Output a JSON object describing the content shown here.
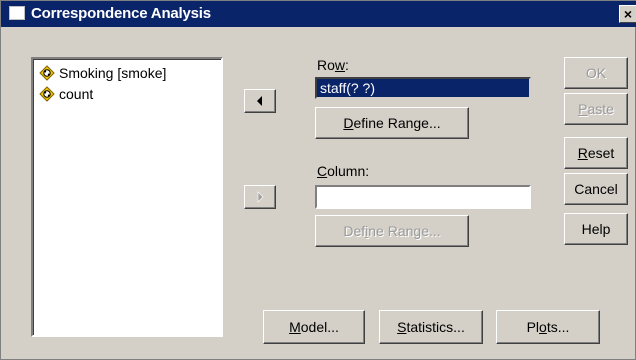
{
  "window": {
    "title": "Correspondence Analysis",
    "close_label": "×"
  },
  "variables": [
    {
      "label": "Smoking [smoke]",
      "icon": "nominal-variable-icon"
    },
    {
      "label": "count",
      "icon": "nominal-variable-icon"
    }
  ],
  "row": {
    "label_prefix": "Ro",
    "label_u": "w",
    "label_suffix": ":",
    "value": "staff(? ?)",
    "define_range": {
      "pre": "",
      "u": "D",
      "post": "efine Range..."
    }
  },
  "column": {
    "label_pre": "",
    "label_u": "C",
    "label_post": "olumn:",
    "value": "",
    "define_range": {
      "pre": "Def",
      "u": "i",
      "post": "ne Range..."
    }
  },
  "side_buttons": {
    "ok": "OK",
    "paste": {
      "pre": "",
      "u": "P",
      "post": "aste"
    },
    "reset": {
      "pre": "",
      "u": "R",
      "post": "eset"
    },
    "cancel": "Cancel",
    "help": "Help"
  },
  "bottom_buttons": {
    "model": {
      "pre": "",
      "u": "M",
      "post": "odel..."
    },
    "statistics": {
      "pre": "",
      "u": "S",
      "post": "tatistics..."
    },
    "plots": {
      "pre": "Pl",
      "u": "o",
      "post": "ts..."
    }
  }
}
